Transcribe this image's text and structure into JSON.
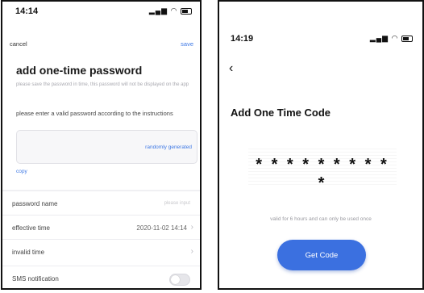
{
  "colors": {
    "accent": "#3f79e5",
    "button": "#3b70e0",
    "panel_bg": "#f4f4f6"
  },
  "left_screen": {
    "status": {
      "time": "14:14",
      "icons": "signal wifi battery"
    },
    "nav": {
      "cancel": "cancel",
      "save": "save"
    },
    "title": "add one-time password",
    "note": "please save the password in time, this password will not be displayed on the app",
    "instruction": "please enter a valid password according to the instructions",
    "randomly_generated": "randomly generated",
    "copy": "copy",
    "rows": [
      {
        "label": "password name",
        "placeholder": "please input"
      },
      {
        "label": "effective time",
        "value": "2020-11-02 14:14"
      },
      {
        "label": "invalid time"
      },
      {
        "label": "SMS notification",
        "toggle": false
      }
    ]
  },
  "right_screen": {
    "status": {
      "time": "14:19",
      "icons": "signal wifi battery"
    },
    "title": "Add One Time Code",
    "code_mask": "* * * * * * * * * *",
    "valid_note": "valid for 6 hours and can only be used once",
    "button_label": "Get Code"
  }
}
